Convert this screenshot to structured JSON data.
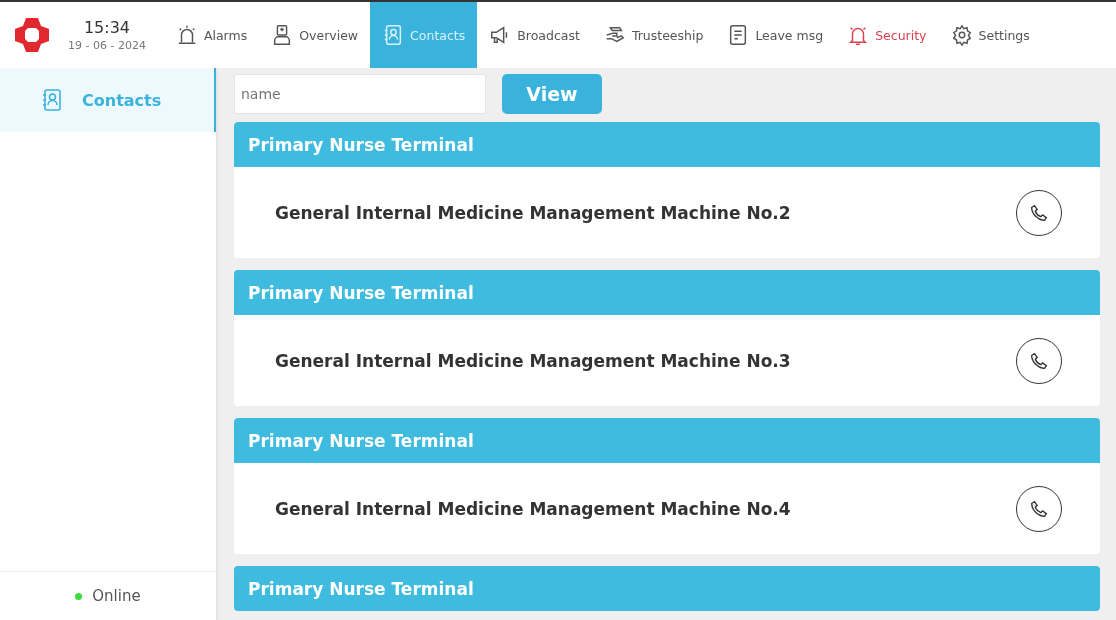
{
  "header": {
    "time": "15:34",
    "date": "19 - 06 - 2024"
  },
  "nav": [
    {
      "kind": "alarm",
      "label": "Alarms",
      "selected": false,
      "alert": false
    },
    {
      "kind": "doctor",
      "label": "Overview",
      "selected": false,
      "alert": false
    },
    {
      "kind": "contacts",
      "label": "Contacts",
      "selected": true,
      "alert": false
    },
    {
      "kind": "megaphone",
      "label": "Broadcast",
      "selected": false,
      "alert": false
    },
    {
      "kind": "hand",
      "label": "Trusteeship",
      "selected": false,
      "alert": false
    },
    {
      "kind": "note",
      "label": "Leave msg",
      "selected": false,
      "alert": false
    },
    {
      "kind": "bell",
      "label": "Security",
      "selected": false,
      "alert": true
    },
    {
      "kind": "gear",
      "label": "Settings",
      "selected": false,
      "alert": false
    }
  ],
  "sidebar": {
    "items": [
      {
        "label": "Contacts",
        "selected": true
      }
    ],
    "status": {
      "label": "Online",
      "color": "#3ddc3d"
    }
  },
  "search": {
    "placeholder": "name",
    "button": "View"
  },
  "cards": [
    {
      "group": "Primary Nurse Terminal",
      "name": "General Internal Medicine Management Machine No.2"
    },
    {
      "group": "Primary Nurse Terminal",
      "name": "General Internal Medicine Management Machine No.3"
    },
    {
      "group": "Primary Nurse Terminal",
      "name": "General Internal Medicine Management Machine No.4"
    },
    {
      "group": "Primary Nurse Terminal"
    }
  ]
}
